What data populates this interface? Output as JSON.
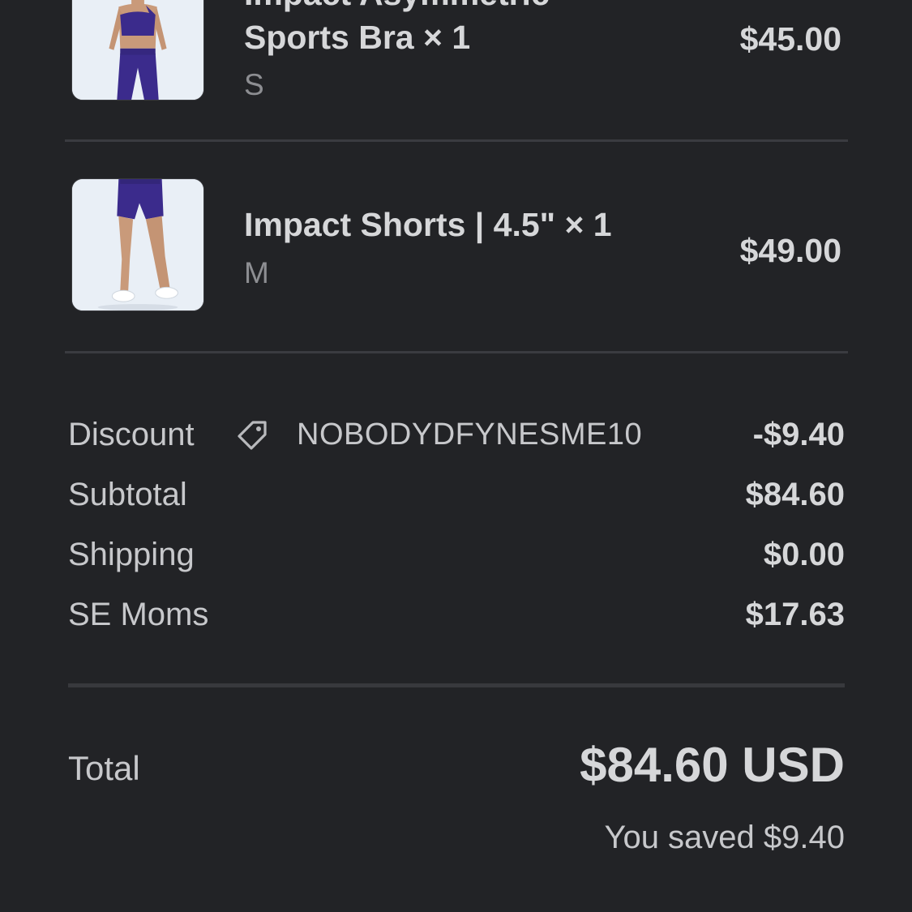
{
  "items": [
    {
      "title_line1": "Impact Asymmetric",
      "title_line2": "Sports Bra × 1",
      "variant": "S",
      "price": "$45.00",
      "image_icon": "product-photo-sports-bra"
    },
    {
      "title": "Impact Shorts | 4.5\" × 1",
      "variant": "M",
      "price": "$49.00",
      "image_icon": "product-photo-shorts"
    }
  ],
  "summary": {
    "discount": {
      "label": "Discount",
      "code": "NOBODYDFYNESME10",
      "value": "-$9.40",
      "icon": "tag-icon"
    },
    "subtotal": {
      "label": "Subtotal",
      "value": "$84.60"
    },
    "shipping": {
      "label": "Shipping",
      "value": "$0.00"
    },
    "tax": {
      "label": "SE Moms",
      "value": "$17.63"
    }
  },
  "total": {
    "label": "Total",
    "value": "$84.60 USD",
    "saved": "You saved $9.40"
  },
  "colors": {
    "background": "#222326",
    "product_purple": "#3b2b8c"
  }
}
